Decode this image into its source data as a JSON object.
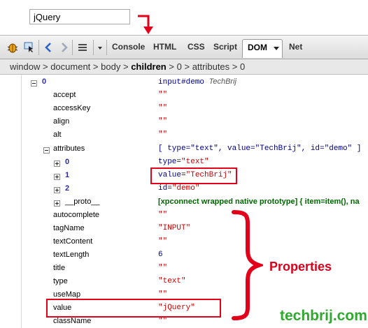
{
  "page": {
    "input_value": "jQuery"
  },
  "toolbar": {
    "tabs": [
      "Console",
      "HTML",
      "CSS",
      "Script",
      "DOM",
      "Net"
    ],
    "active_tab": "DOM"
  },
  "breadcrumb": {
    "items": [
      "window",
      "document",
      "body",
      "children",
      "0",
      "attributes",
      "0"
    ],
    "separator": ">"
  },
  "dom": {
    "root": {
      "name": "0",
      "value_tag": "input#demo",
      "value_title": "TechBrij"
    },
    "rows": [
      {
        "name": "accept",
        "value": "\"\""
      },
      {
        "name": "accessKey",
        "value": "\"\""
      },
      {
        "name": "align",
        "value": "\"\""
      },
      {
        "name": "alt",
        "value": "\"\""
      }
    ],
    "attributes": {
      "name": "attributes",
      "value": "[ type=\"text\",  value=\"TechBrij\",  id=\"demo\" ]",
      "children": [
        {
          "name": "0",
          "value_key": "type",
          "value_val": "\"text\""
        },
        {
          "name": "1",
          "value_key": "value",
          "value_val": "\"TechBrij\""
        },
        {
          "name": "2",
          "value_key": "id",
          "value_val": "\"demo\""
        },
        {
          "name": "__proto__",
          "value": "[xpconnect wrapped native prototype] {  item=item(),  na"
        }
      ]
    },
    "rows2": [
      {
        "name": "autocomplete",
        "value": "\"\""
      },
      {
        "name": "tagName",
        "value": "\"INPUT\""
      },
      {
        "name": "textContent",
        "value": "\"\""
      },
      {
        "name": "textLength",
        "value": "6"
      },
      {
        "name": "title",
        "value": "\"\""
      },
      {
        "name": "type",
        "value": "\"text\""
      },
      {
        "name": "useMap",
        "value": "\"\""
      },
      {
        "name": "value",
        "value": "\"jQuery\""
      },
      {
        "name": "className",
        "value": "\"\""
      }
    ]
  },
  "annotations": {
    "properties_label": "Properties",
    "watermark": "techbrij.com"
  },
  "colors": {
    "annotation_red": "#d9001b",
    "watermark_green": "#2fa82f",
    "string_red": "#cc0000",
    "number_blue": "#2b2bb0"
  }
}
